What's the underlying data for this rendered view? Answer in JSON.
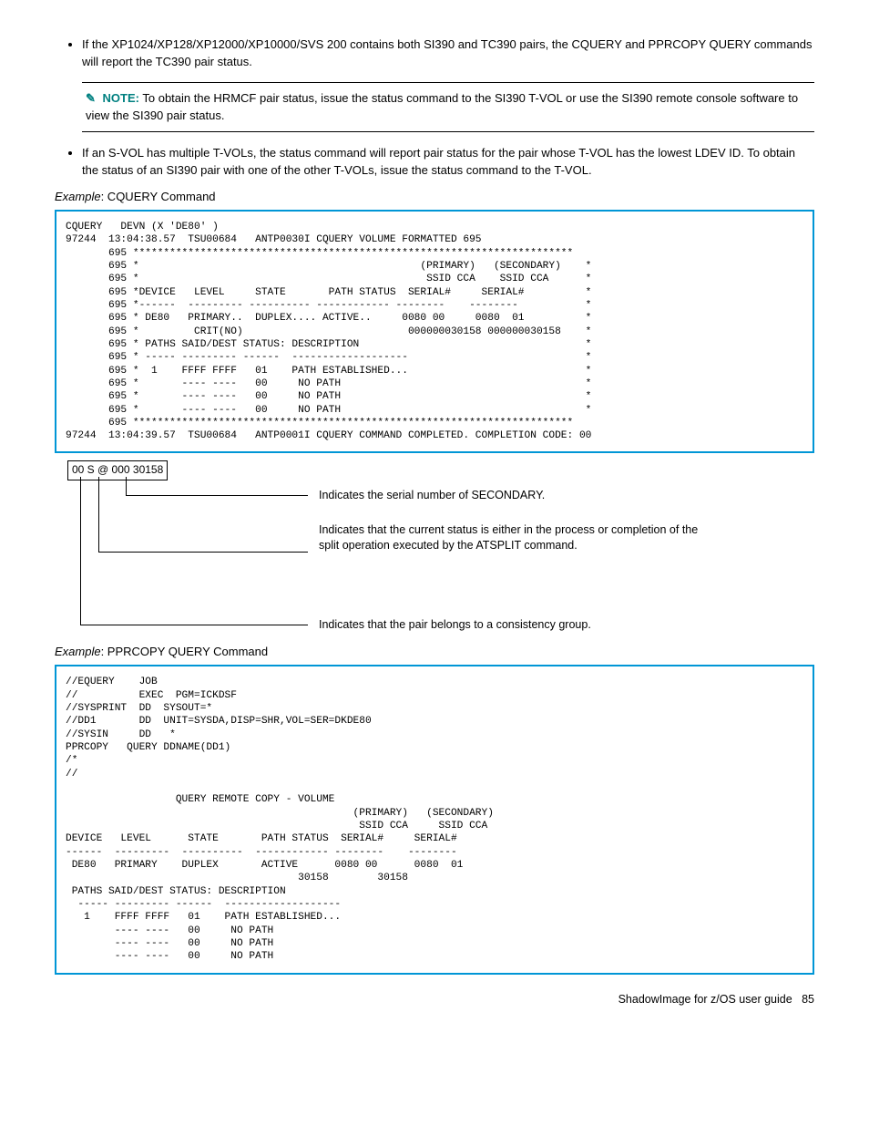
{
  "bullet1": "If the XP1024/XP128/XP12000/XP10000/SVS 200 contains both SI390 and TC390 pairs, the CQUERY and PPRCOPY QUERY commands will report the TC390 pair status.",
  "note": {
    "label": "NOTE:",
    "text": "To obtain the HRMCF pair status, issue the status command to the SI390 T-VOL or use the SI390 remote console software to view the SI390 pair status."
  },
  "bullet2": "If an S-VOL has multiple T-VOLs, the status command will report pair status for the pair whose T-VOL has the lowest LDEV ID. To obtain the status of an SI390 pair with one of the other T-VOLs, issue the status command to the T-VOL.",
  "example1_label_italic": "Example",
  "example1_label_rest": ": CQUERY Command",
  "code1": "CQUERY   DEVN (X 'DE80' )\n97244  13:04:38.57  TSU00684   ANTP0030I CQUERY VOLUME FORMATTED 695\n       695 ************************************************************************\n       695 *                                              (PRIMARY)   (SECONDARY)    *\n       695 *                                               SSID CCA    SSID CCA      *\n       695 *DEVICE   LEVEL     STATE       PATH STATUS  SERIAL#     SERIAL#          *\n       695 *------  --------- ---------- ------------ --------    --------           *\n       695 * DE80   PRIMARY..  DUPLEX.... ACTIVE..     0080 00     0080  01          *\n       695 *         CRIT(NO)                           000000030158 000000030158    *\n       695 * PATHS SAID/DEST STATUS: DESCRIPTION                                     *\n       695 * ----- --------- ------  -------------------                             *\n       695 *  1    FFFF FFFF   01    PATH ESTABLISHED...                             *\n       695 *       ---- ----   00     NO PATH                                        *\n       695 *       ---- ----   00     NO PATH                                        *\n       695 *       ---- ----   00     NO PATH                                        *\n       695 ************************************************************************\n97244  13:04:39.57  TSU00684   ANTP0001I CQUERY COMMAND COMPLETED. COMPLETION CODE: 00",
  "legend": {
    "boxed": "00 S @ 000 30158",
    "t1": "Indicates the serial number of SECONDARY.",
    "t2": "Indicates that the current status is either in the process or completion of the split operation executed by the ATSPLIT command.",
    "t3": "Indicates that the pair belongs to a consistency group."
  },
  "example2_label_italic": "Example",
  "example2_label_rest": ": PPRCOPY QUERY Command",
  "code2": "//EQUERY    JOB\n//          EXEC  PGM=ICKDSF\n//SYSPRINT  DD  SYSOUT=*\n//DD1       DD  UNIT=SYSDA,DISP=SHR,VOL=SER=DKDE80\n//SYSIN     DD   *\nPPRCOPY   QUERY DDNAME(DD1)\n/*\n//\n\n                  QUERY REMOTE COPY - VOLUME\n                                               (PRIMARY)   (SECONDARY)\n                                                SSID CCA     SSID CCA\nDEVICE   LEVEL      STATE       PATH STATUS  SERIAL#     SERIAL#\n------  ---------  ----------  ------------ --------    --------\n DE80   PRIMARY    DUPLEX       ACTIVE      0080 00      0080  01\n                                      30158        30158\n PATHS SAID/DEST STATUS: DESCRIPTION\n  ----- --------- ------  -------------------\n   1    FFFF FFFF   01    PATH ESTABLISHED...\n        ---- ----   00     NO PATH\n        ---- ----   00     NO PATH\n        ---- ----   00     NO PATH",
  "footer": "ShadowImage for z/OS user guide",
  "page": "85"
}
